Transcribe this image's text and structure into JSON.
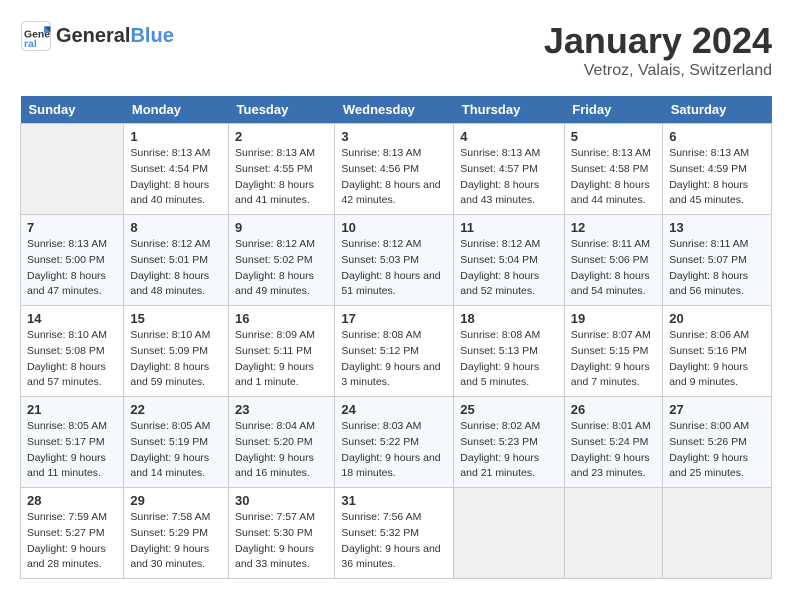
{
  "header": {
    "logo_general": "General",
    "logo_blue": "Blue",
    "title": "January 2024",
    "subtitle": "Vetroz, Valais, Switzerland"
  },
  "calendar": {
    "days_of_week": [
      "Sunday",
      "Monday",
      "Tuesday",
      "Wednesday",
      "Thursday",
      "Friday",
      "Saturday"
    ],
    "weeks": [
      [
        {
          "day": "",
          "empty": true
        },
        {
          "day": "1",
          "sunrise": "8:13 AM",
          "sunset": "4:54 PM",
          "daylight": "8 hours and 40 minutes."
        },
        {
          "day": "2",
          "sunrise": "8:13 AM",
          "sunset": "4:55 PM",
          "daylight": "8 hours and 41 minutes."
        },
        {
          "day": "3",
          "sunrise": "8:13 AM",
          "sunset": "4:56 PM",
          "daylight": "8 hours and 42 minutes."
        },
        {
          "day": "4",
          "sunrise": "8:13 AM",
          "sunset": "4:57 PM",
          "daylight": "8 hours and 43 minutes."
        },
        {
          "day": "5",
          "sunrise": "8:13 AM",
          "sunset": "4:58 PM",
          "daylight": "8 hours and 44 minutes."
        },
        {
          "day": "6",
          "sunrise": "8:13 AM",
          "sunset": "4:59 PM",
          "daylight": "8 hours and 45 minutes."
        }
      ],
      [
        {
          "day": "7",
          "sunrise": "8:13 AM",
          "sunset": "5:00 PM",
          "daylight": "8 hours and 47 minutes."
        },
        {
          "day": "8",
          "sunrise": "8:12 AM",
          "sunset": "5:01 PM",
          "daylight": "8 hours and 48 minutes."
        },
        {
          "day": "9",
          "sunrise": "8:12 AM",
          "sunset": "5:02 PM",
          "daylight": "8 hours and 49 minutes."
        },
        {
          "day": "10",
          "sunrise": "8:12 AM",
          "sunset": "5:03 PM",
          "daylight": "8 hours and 51 minutes."
        },
        {
          "day": "11",
          "sunrise": "8:12 AM",
          "sunset": "5:04 PM",
          "daylight": "8 hours and 52 minutes."
        },
        {
          "day": "12",
          "sunrise": "8:11 AM",
          "sunset": "5:06 PM",
          "daylight": "8 hours and 54 minutes."
        },
        {
          "day": "13",
          "sunrise": "8:11 AM",
          "sunset": "5:07 PM",
          "daylight": "8 hours and 56 minutes."
        }
      ],
      [
        {
          "day": "14",
          "sunrise": "8:10 AM",
          "sunset": "5:08 PM",
          "daylight": "8 hours and 57 minutes."
        },
        {
          "day": "15",
          "sunrise": "8:10 AM",
          "sunset": "5:09 PM",
          "daylight": "8 hours and 59 minutes."
        },
        {
          "day": "16",
          "sunrise": "8:09 AM",
          "sunset": "5:11 PM",
          "daylight": "9 hours and 1 minute."
        },
        {
          "day": "17",
          "sunrise": "8:08 AM",
          "sunset": "5:12 PM",
          "daylight": "9 hours and 3 minutes."
        },
        {
          "day": "18",
          "sunrise": "8:08 AM",
          "sunset": "5:13 PM",
          "daylight": "9 hours and 5 minutes."
        },
        {
          "day": "19",
          "sunrise": "8:07 AM",
          "sunset": "5:15 PM",
          "daylight": "9 hours and 7 minutes."
        },
        {
          "day": "20",
          "sunrise": "8:06 AM",
          "sunset": "5:16 PM",
          "daylight": "9 hours and 9 minutes."
        }
      ],
      [
        {
          "day": "21",
          "sunrise": "8:05 AM",
          "sunset": "5:17 PM",
          "daylight": "9 hours and 11 minutes."
        },
        {
          "day": "22",
          "sunrise": "8:05 AM",
          "sunset": "5:19 PM",
          "daylight": "9 hours and 14 minutes."
        },
        {
          "day": "23",
          "sunrise": "8:04 AM",
          "sunset": "5:20 PM",
          "daylight": "9 hours and 16 minutes."
        },
        {
          "day": "24",
          "sunrise": "8:03 AM",
          "sunset": "5:22 PM",
          "daylight": "9 hours and 18 minutes."
        },
        {
          "day": "25",
          "sunrise": "8:02 AM",
          "sunset": "5:23 PM",
          "daylight": "9 hours and 21 minutes."
        },
        {
          "day": "26",
          "sunrise": "8:01 AM",
          "sunset": "5:24 PM",
          "daylight": "9 hours and 23 minutes."
        },
        {
          "day": "27",
          "sunrise": "8:00 AM",
          "sunset": "5:26 PM",
          "daylight": "9 hours and 25 minutes."
        }
      ],
      [
        {
          "day": "28",
          "sunrise": "7:59 AM",
          "sunset": "5:27 PM",
          "daylight": "9 hours and 28 minutes."
        },
        {
          "day": "29",
          "sunrise": "7:58 AM",
          "sunset": "5:29 PM",
          "daylight": "9 hours and 30 minutes."
        },
        {
          "day": "30",
          "sunrise": "7:57 AM",
          "sunset": "5:30 PM",
          "daylight": "9 hours and 33 minutes."
        },
        {
          "day": "31",
          "sunrise": "7:56 AM",
          "sunset": "5:32 PM",
          "daylight": "9 hours and 36 minutes."
        },
        {
          "day": "",
          "empty": true
        },
        {
          "day": "",
          "empty": true
        },
        {
          "day": "",
          "empty": true
        }
      ]
    ]
  }
}
